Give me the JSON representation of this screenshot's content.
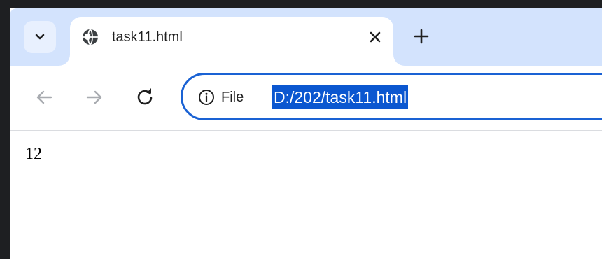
{
  "tab": {
    "title": "task11.html",
    "favicon": "globe-icon"
  },
  "toolbar": {
    "back_icon": "arrow-left-icon",
    "forward_icon": "arrow-right-icon",
    "reload_icon": "reload-icon"
  },
  "omnibox": {
    "site_info_icon": "info-icon",
    "scheme_label": "File",
    "url": "D:/202/task11.html"
  },
  "page": {
    "content": "12"
  },
  "colors": {
    "tabstrip_bg": "#d3e3fd",
    "omnibox_border": "#1a62d4",
    "url_selection": "#0b57d0"
  }
}
